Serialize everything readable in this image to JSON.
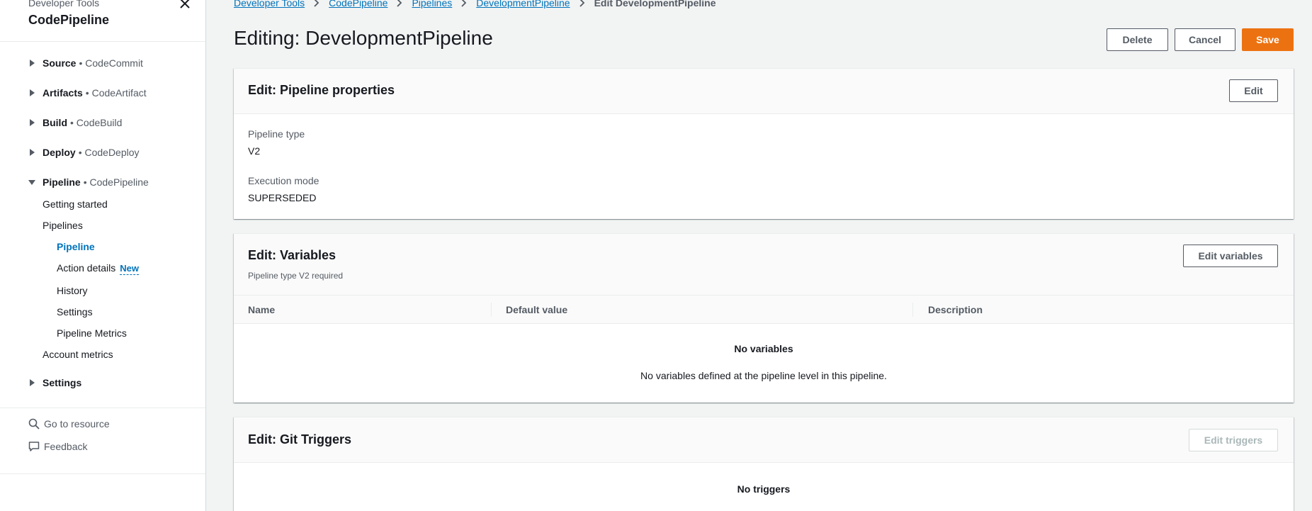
{
  "sidebar": {
    "service": "Developer Tools",
    "title": "CodePipeline",
    "sections": [
      {
        "label": "Source",
        "sub": "• CodeCommit"
      },
      {
        "label": "Artifacts",
        "sub": "• CodeArtifact"
      },
      {
        "label": "Build",
        "sub": "• CodeBuild"
      },
      {
        "label": "Deploy",
        "sub": "• CodeDeploy"
      },
      {
        "label": "Pipeline",
        "sub": "• CodePipeline"
      },
      {
        "label": "Settings"
      }
    ],
    "pipeline_items": {
      "getting_started": "Getting started",
      "pipelines": "Pipelines",
      "pipeline": "Pipeline",
      "action_details": "Action details",
      "new_badge": "New",
      "history": "History",
      "settings": "Settings",
      "pipeline_metrics": "Pipeline Metrics",
      "account_metrics": "Account metrics"
    },
    "utilities": {
      "go_to_resource": "Go to resource",
      "feedback": "Feedback"
    }
  },
  "breadcrumb": {
    "items": [
      "Developer Tools",
      "CodePipeline",
      "Pipelines",
      "DevelopmentPipeline"
    ],
    "current": "Edit DevelopmentPipeline"
  },
  "header": {
    "title": "Editing: DevelopmentPipeline",
    "delete_label": "Delete",
    "cancel_label": "Cancel",
    "save_label": "Save"
  },
  "properties": {
    "title": "Edit: Pipeline properties",
    "edit_label": "Edit",
    "pipeline_type_label": "Pipeline type",
    "pipeline_type_value": "V2",
    "execution_mode_label": "Execution mode",
    "execution_mode_value": "SUPERSEDED"
  },
  "variables": {
    "title": "Edit: Variables",
    "description": "Pipeline type V2 required",
    "edit_label": "Edit variables",
    "columns": [
      "Name",
      "Default value",
      "Description"
    ],
    "empty_title": "No variables",
    "empty_description": "No variables defined at the pipeline level in this pipeline."
  },
  "triggers": {
    "title": "Edit: Git Triggers",
    "edit_label": "Edit triggers",
    "empty_title": "No triggers"
  },
  "colors": {
    "primary": "#ec7211",
    "link": "#0073bb",
    "text": "#16191f",
    "muted": "#545b64",
    "background": "#f2f3f3"
  }
}
